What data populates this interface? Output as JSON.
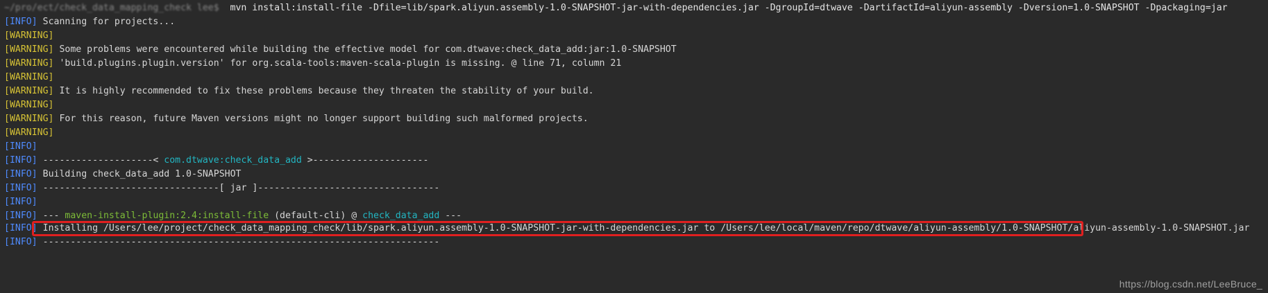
{
  "command": {
    "prompt": "~/pro/ect/check_data_mapping_check lee$",
    "text": "mvn install:install-file -Dfile=lib/spark.aliyun.assembly-1.0-SNAPSHOT-jar-with-dependencies.jar -DgroupId=dtwave -DartifactId=aliyun-assembly -Dversion=1.0-SNAPSHOT -Dpackaging=jar"
  },
  "levels": {
    "info": "INFO",
    "warning": "WARNING"
  },
  "lines": [
    {
      "level": "info",
      "text": "Scanning for projects..."
    },
    {
      "level": "warning",
      "text": ""
    },
    {
      "level": "warning",
      "text": "Some problems were encountered while building the effective model for com.dtwave:check_data_add:jar:1.0-SNAPSHOT"
    },
    {
      "level": "warning",
      "text": "'build.plugins.plugin.version' for org.scala-tools:maven-scala-plugin is missing. @ line 71, column 21"
    },
    {
      "level": "warning",
      "text": ""
    },
    {
      "level": "warning",
      "text": "It is highly recommended to fix these problems because they threaten the stability of your build."
    },
    {
      "level": "warning",
      "text": ""
    },
    {
      "level": "warning",
      "text": "For this reason, future Maven versions might no longer support building such malformed projects."
    },
    {
      "level": "warning",
      "text": ""
    },
    {
      "level": "info",
      "text": ""
    },
    {
      "level": "info",
      "pre": "--------------------< ",
      "accent": "com.dtwave:check_data_add",
      "post": " >---------------------"
    },
    {
      "level": "info",
      "text": "Building check_data_add 1.0-SNAPSHOT"
    },
    {
      "level": "info",
      "text": "--------------------------------[ jar ]---------------------------------"
    },
    {
      "level": "info",
      "text": ""
    },
    {
      "level": "info",
      "pre": "--- ",
      "plugin": "maven-install-plugin:2.4:install-file",
      "mid": " (default-cli) @ ",
      "accent": "check_data_add",
      "post": " ---"
    },
    {
      "level": "info",
      "text": "Installing /Users/lee/project/check_data_mapping_check/lib/spark.aliyun.assembly-1.0-SNAPSHOT-jar-with-dependencies.jar to /Users/lee/local/maven/repo/dtwave/aliyun-assembly/1.0-SNAPSHOT/aliyun-assembly-1.0-SNAPSHOT.jar"
    },
    {
      "level": "info",
      "text": "------------------------------------------------------------------------"
    }
  ],
  "watermark": "https://blog.csdn.net/LeeBruce_",
  "colors": {
    "background": "#2a2a2a",
    "info": "#4f8bff",
    "warning": "#d6c235",
    "accent_cyan": "#22b6c2",
    "accent_green": "#7dbc38",
    "highlight_border": "#e02020"
  }
}
